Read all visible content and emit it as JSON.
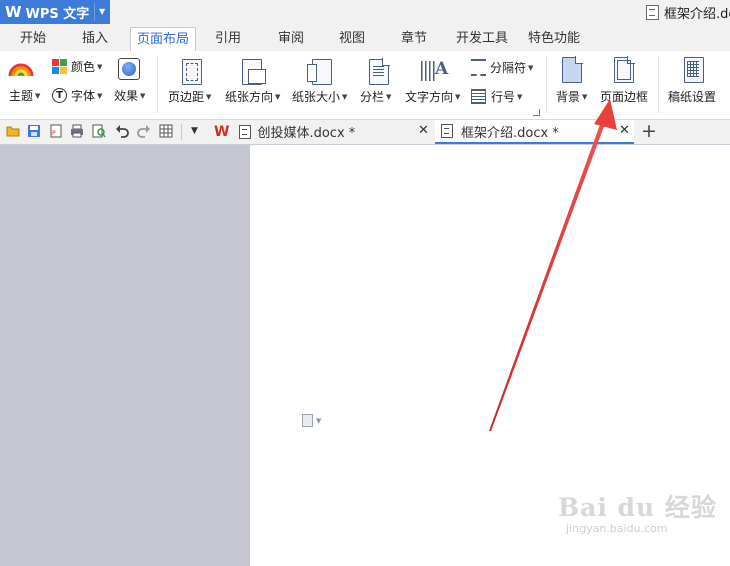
{
  "titlebar": {
    "app_logo": "W",
    "app_name": "WPS 文字",
    "doc_title": "框架介绍.dc"
  },
  "ribbon_tabs": [
    {
      "label": "开始"
    },
    {
      "label": "插入"
    },
    {
      "label": "页面布局",
      "active": true
    },
    {
      "label": "引用"
    },
    {
      "label": "审阅"
    },
    {
      "label": "视图"
    },
    {
      "label": "章节"
    },
    {
      "label": "开发工具"
    },
    {
      "label": "特色功能"
    }
  ],
  "ribbon": {
    "theme": "主题",
    "colors": "颜色",
    "fonts": "字体",
    "effects": "效果",
    "margins": "页边距",
    "orientation": "纸张方向",
    "size": "纸张大小",
    "columns": "分栏",
    "text_direction": "文字方向",
    "breaks": "分隔符",
    "line_numbers": "行号",
    "background": "背景",
    "page_borders": "页面边框",
    "manuscript": "稿纸设置"
  },
  "doc_tabs": [
    {
      "label": "创投媒体.docx *"
    },
    {
      "label": "框架介绍.docx *",
      "active": true
    }
  ],
  "watermark": {
    "main": "Bai du 经验",
    "sub": "jingyan.baidu.com"
  },
  "colors": {
    "accent": "#3d7bd9",
    "active_tab_text": "#2a6bd1",
    "annotation_arrow": "#e8403a",
    "gray_area": "#c5c6d0"
  }
}
